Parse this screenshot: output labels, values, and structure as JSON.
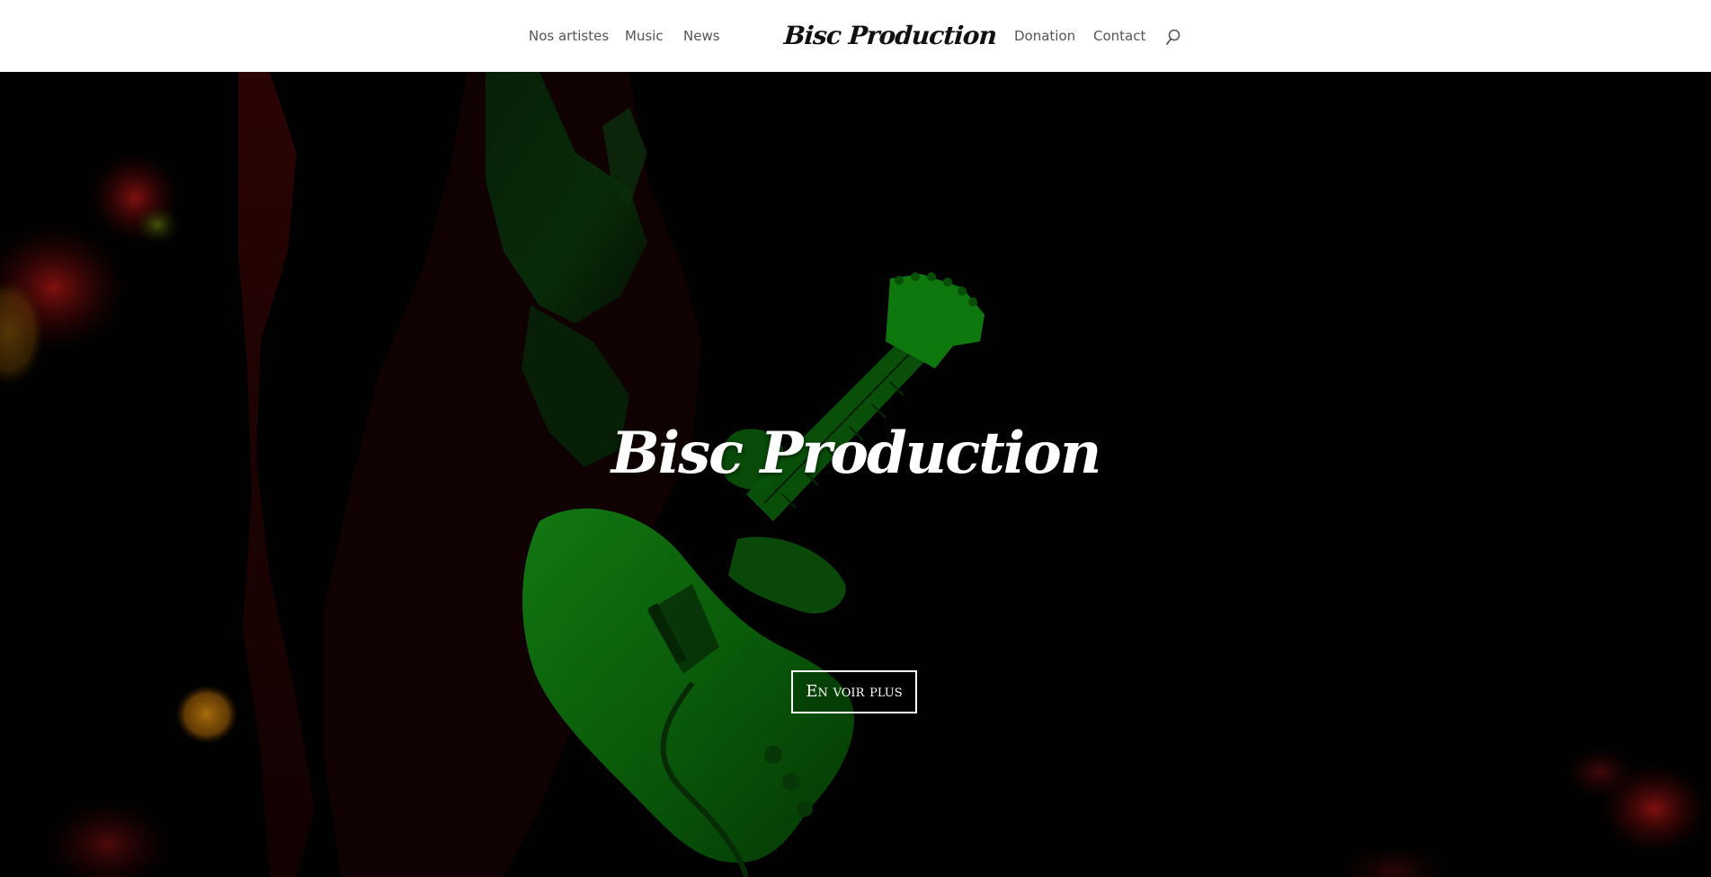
{
  "header": {
    "logo_text": "Bisc Production",
    "nav_left": [
      {
        "label": "Nos artistes"
      },
      {
        "label": "Music"
      },
      {
        "label": "News"
      }
    ],
    "nav_right": [
      {
        "label": "Donation"
      },
      {
        "label": "Contact"
      }
    ],
    "search_icon": "search-icon",
    "background": "#ffffff",
    "nav_color": "#555555"
  },
  "hero": {
    "title": "Bisc Production",
    "button_label": "En voir plus",
    "image_icon": "guitarist-photo",
    "tint_green": "#0a8a0a",
    "tint_red": "#7a0a0a"
  }
}
